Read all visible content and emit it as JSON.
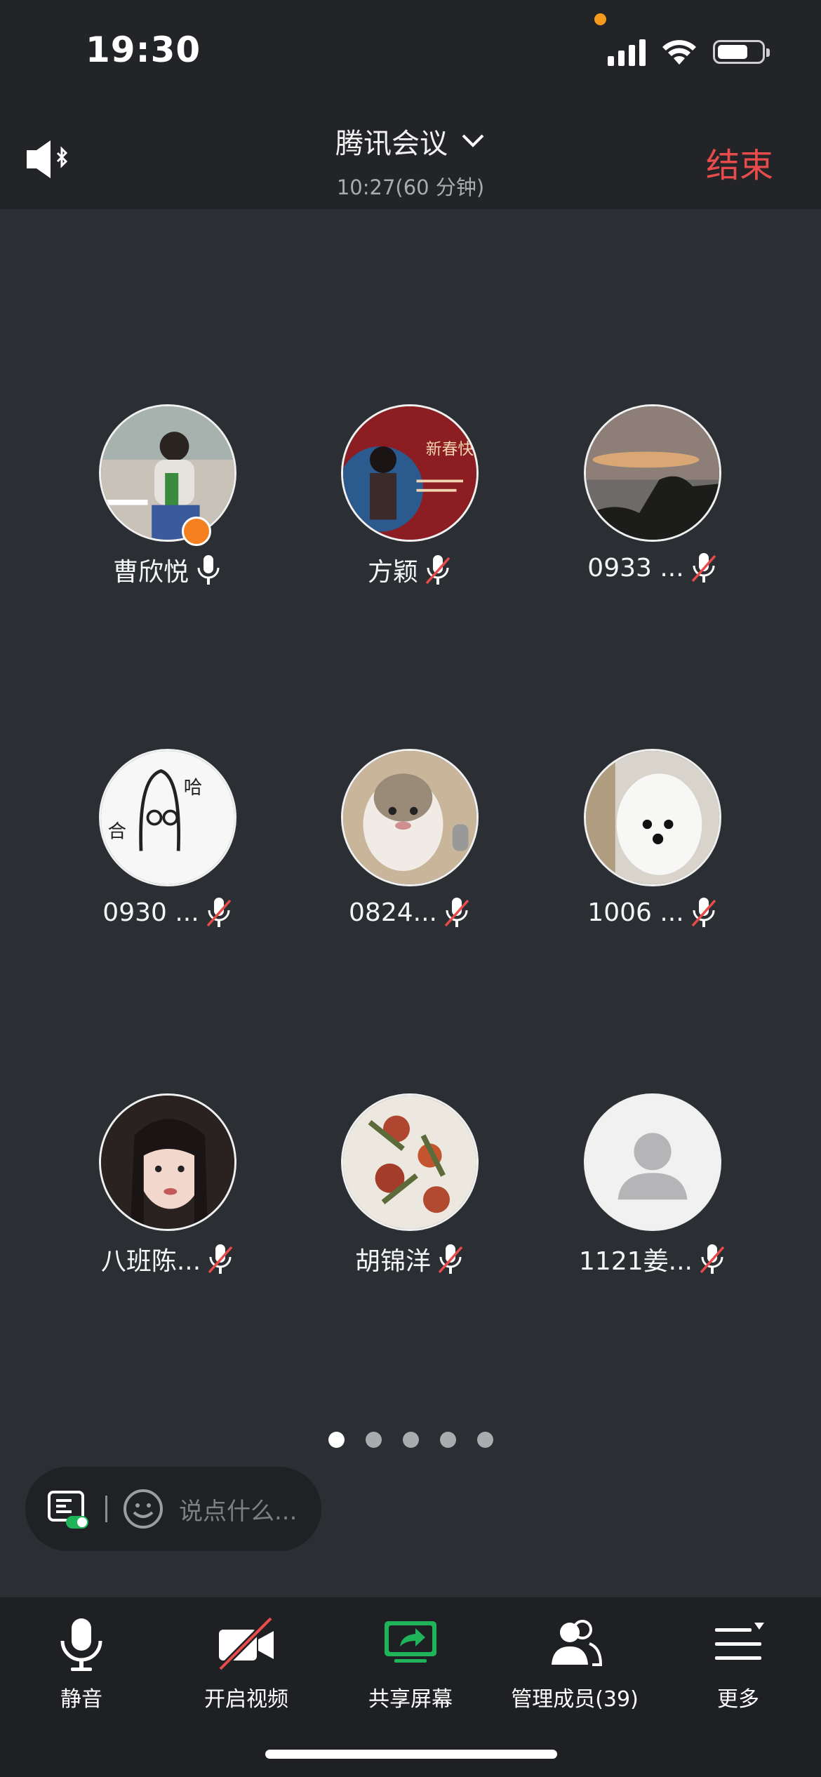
{
  "status_bar": {
    "time": "19:30"
  },
  "header": {
    "title": "腾讯会议",
    "subtitle": "10:27(60 分钟)",
    "end_label": "结束"
  },
  "participants": [
    {
      "name": "曹欣悦",
      "mic": "on",
      "host": true,
      "avatar": "photo-girl"
    },
    {
      "name": "方颖",
      "mic": "muted",
      "host": false,
      "avatar": "photo-red"
    },
    {
      "name": "0933 ...",
      "mic": "muted",
      "host": false,
      "avatar": "photo-sky"
    },
    {
      "name": "0930 ...",
      "mic": "muted",
      "host": false,
      "avatar": "drawing"
    },
    {
      "name": "0824...",
      "mic": "muted",
      "host": false,
      "avatar": "cat"
    },
    {
      "name": "1006 ...",
      "mic": "muted",
      "host": false,
      "avatar": "dog"
    },
    {
      "name": "八班陈...",
      "mic": "muted",
      "host": false,
      "avatar": "photo-portrait"
    },
    {
      "name": "胡锦洋",
      "mic": "muted",
      "host": false,
      "avatar": "flowers"
    },
    {
      "name": "1121姜...",
      "mic": "muted",
      "host": false,
      "avatar": "default"
    }
  ],
  "pagination": {
    "pages": 5,
    "current": 1
  },
  "chat": {
    "placeholder": "说点什么..."
  },
  "toolbar": {
    "mute": "静音",
    "video": "开启视频",
    "share": "共享屏幕",
    "members": "管理成员(39)",
    "more": "更多"
  },
  "colors": {
    "accent_green": "#1fb45a",
    "end_red": "#e84b4b",
    "host_orange": "#f5801f"
  }
}
